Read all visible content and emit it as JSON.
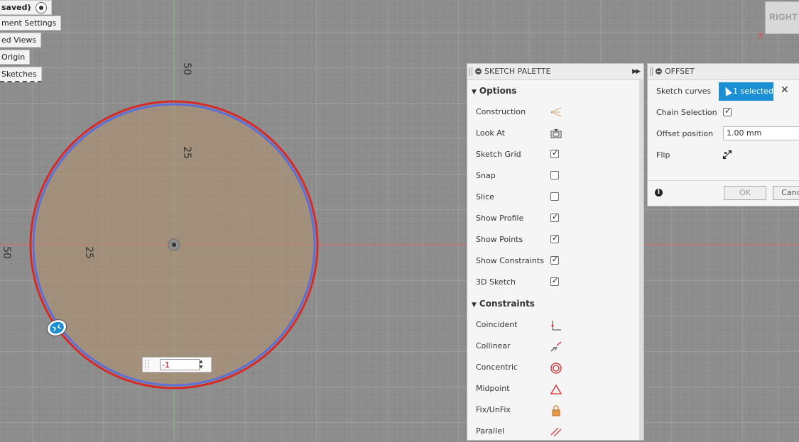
{
  "browser_tree": {
    "items": [
      {
        "label": "saved)"
      },
      {
        "label": "ment Settings"
      },
      {
        "label": "ed Views"
      },
      {
        "label": "Origin"
      },
      {
        "label": "Sketches"
      }
    ]
  },
  "canvas": {
    "axis_labels": {
      "top_50": "50",
      "top_25": "25",
      "left_25": "25",
      "left_edge": "50"
    },
    "dimension_input_value": "-1",
    "colors": {
      "outer_circle": "#d42a2a",
      "inner_circle": "#5b6fd6",
      "profile_fill": "#b1916f",
      "x_axis": "#d96060",
      "y_axis": "#79c179"
    }
  },
  "viewcube": {
    "label": "RIGHT",
    "axis_marker": "X"
  },
  "sketch_palette": {
    "title": "SKETCH PALETTE",
    "options_header": "Options",
    "options": [
      {
        "label": "Construction",
        "control": "construction-icon"
      },
      {
        "label": "Look At",
        "control": "look-at-icon"
      },
      {
        "label": "Sketch Grid",
        "control": "checkbox",
        "checked": true
      },
      {
        "label": "Snap",
        "control": "checkbox",
        "checked": false
      },
      {
        "label": "Slice",
        "control": "checkbox",
        "checked": false
      },
      {
        "label": "Show Profile",
        "control": "checkbox",
        "checked": true
      },
      {
        "label": "Show Points",
        "control": "checkbox",
        "checked": true
      },
      {
        "label": "Show Constraints",
        "control": "checkbox",
        "checked": true
      },
      {
        "label": "3D Sketch",
        "control": "checkbox",
        "checked": true
      }
    ],
    "constraints_header": "Constraints",
    "constraints": [
      {
        "label": "Coincident",
        "icon": "coincident-icon"
      },
      {
        "label": "Collinear",
        "icon": "collinear-icon"
      },
      {
        "label": "Concentric",
        "icon": "concentric-icon"
      },
      {
        "label": "Midpoint",
        "icon": "midpoint-icon"
      },
      {
        "label": "Fix/UnFix",
        "icon": "lock-icon"
      },
      {
        "label": "Parallel",
        "icon": "parallel-icon"
      }
    ]
  },
  "offset_dialog": {
    "title": "OFFSET",
    "sketch_curves_label": "Sketch curves",
    "sketch_curves_value": "1 selected",
    "chain_selection_label": "Chain Selection",
    "chain_selection_checked": true,
    "offset_position_label": "Offset position",
    "offset_position_value": "1.00 mm",
    "flip_label": "Flip",
    "ok_label": "OK",
    "cancel_label": "Canc"
  }
}
